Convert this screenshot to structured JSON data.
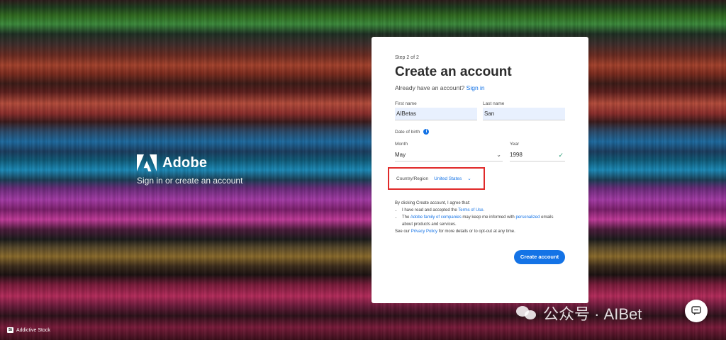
{
  "brand": {
    "name": "Adobe",
    "tagline": "Sign in or create an account"
  },
  "form": {
    "step": "Step 2 of 2",
    "title": "Create an account",
    "have_account": "Already have an account?",
    "sign_in": "Sign in",
    "first_name_label": "First name",
    "first_name_value": "AIBetas",
    "last_name_label": "Last name",
    "last_name_value": "San",
    "dob_label": "Date of birth",
    "month_label": "Month",
    "month_value": "May",
    "year_label": "Year",
    "year_value": "1998",
    "country_label": "Country/Region",
    "country_value": "United States",
    "legal_intro": "By clicking Create account, I agree that:",
    "legal_1a": "I have read and accepted the",
    "terms_link": "Terms of Use",
    "legal_2a": "The",
    "family_link": "Adobe family of companies",
    "legal_2b": "may keep me informed with",
    "personalized_link": "personalized",
    "legal_2c": "emails about products and services.",
    "legal_3a": "See our",
    "privacy_link": "Privacy Policy",
    "legal_3b": "for more details or to opt-out at any time.",
    "submit": "Create account"
  },
  "credit": {
    "badge": "St",
    "text": "Addictive Stock"
  },
  "watermark": {
    "text": "公众号 · AIBet"
  },
  "colors": {
    "accent": "#1473e6",
    "highlight": "#e02a2a",
    "autofill": "#e8f0fe"
  }
}
